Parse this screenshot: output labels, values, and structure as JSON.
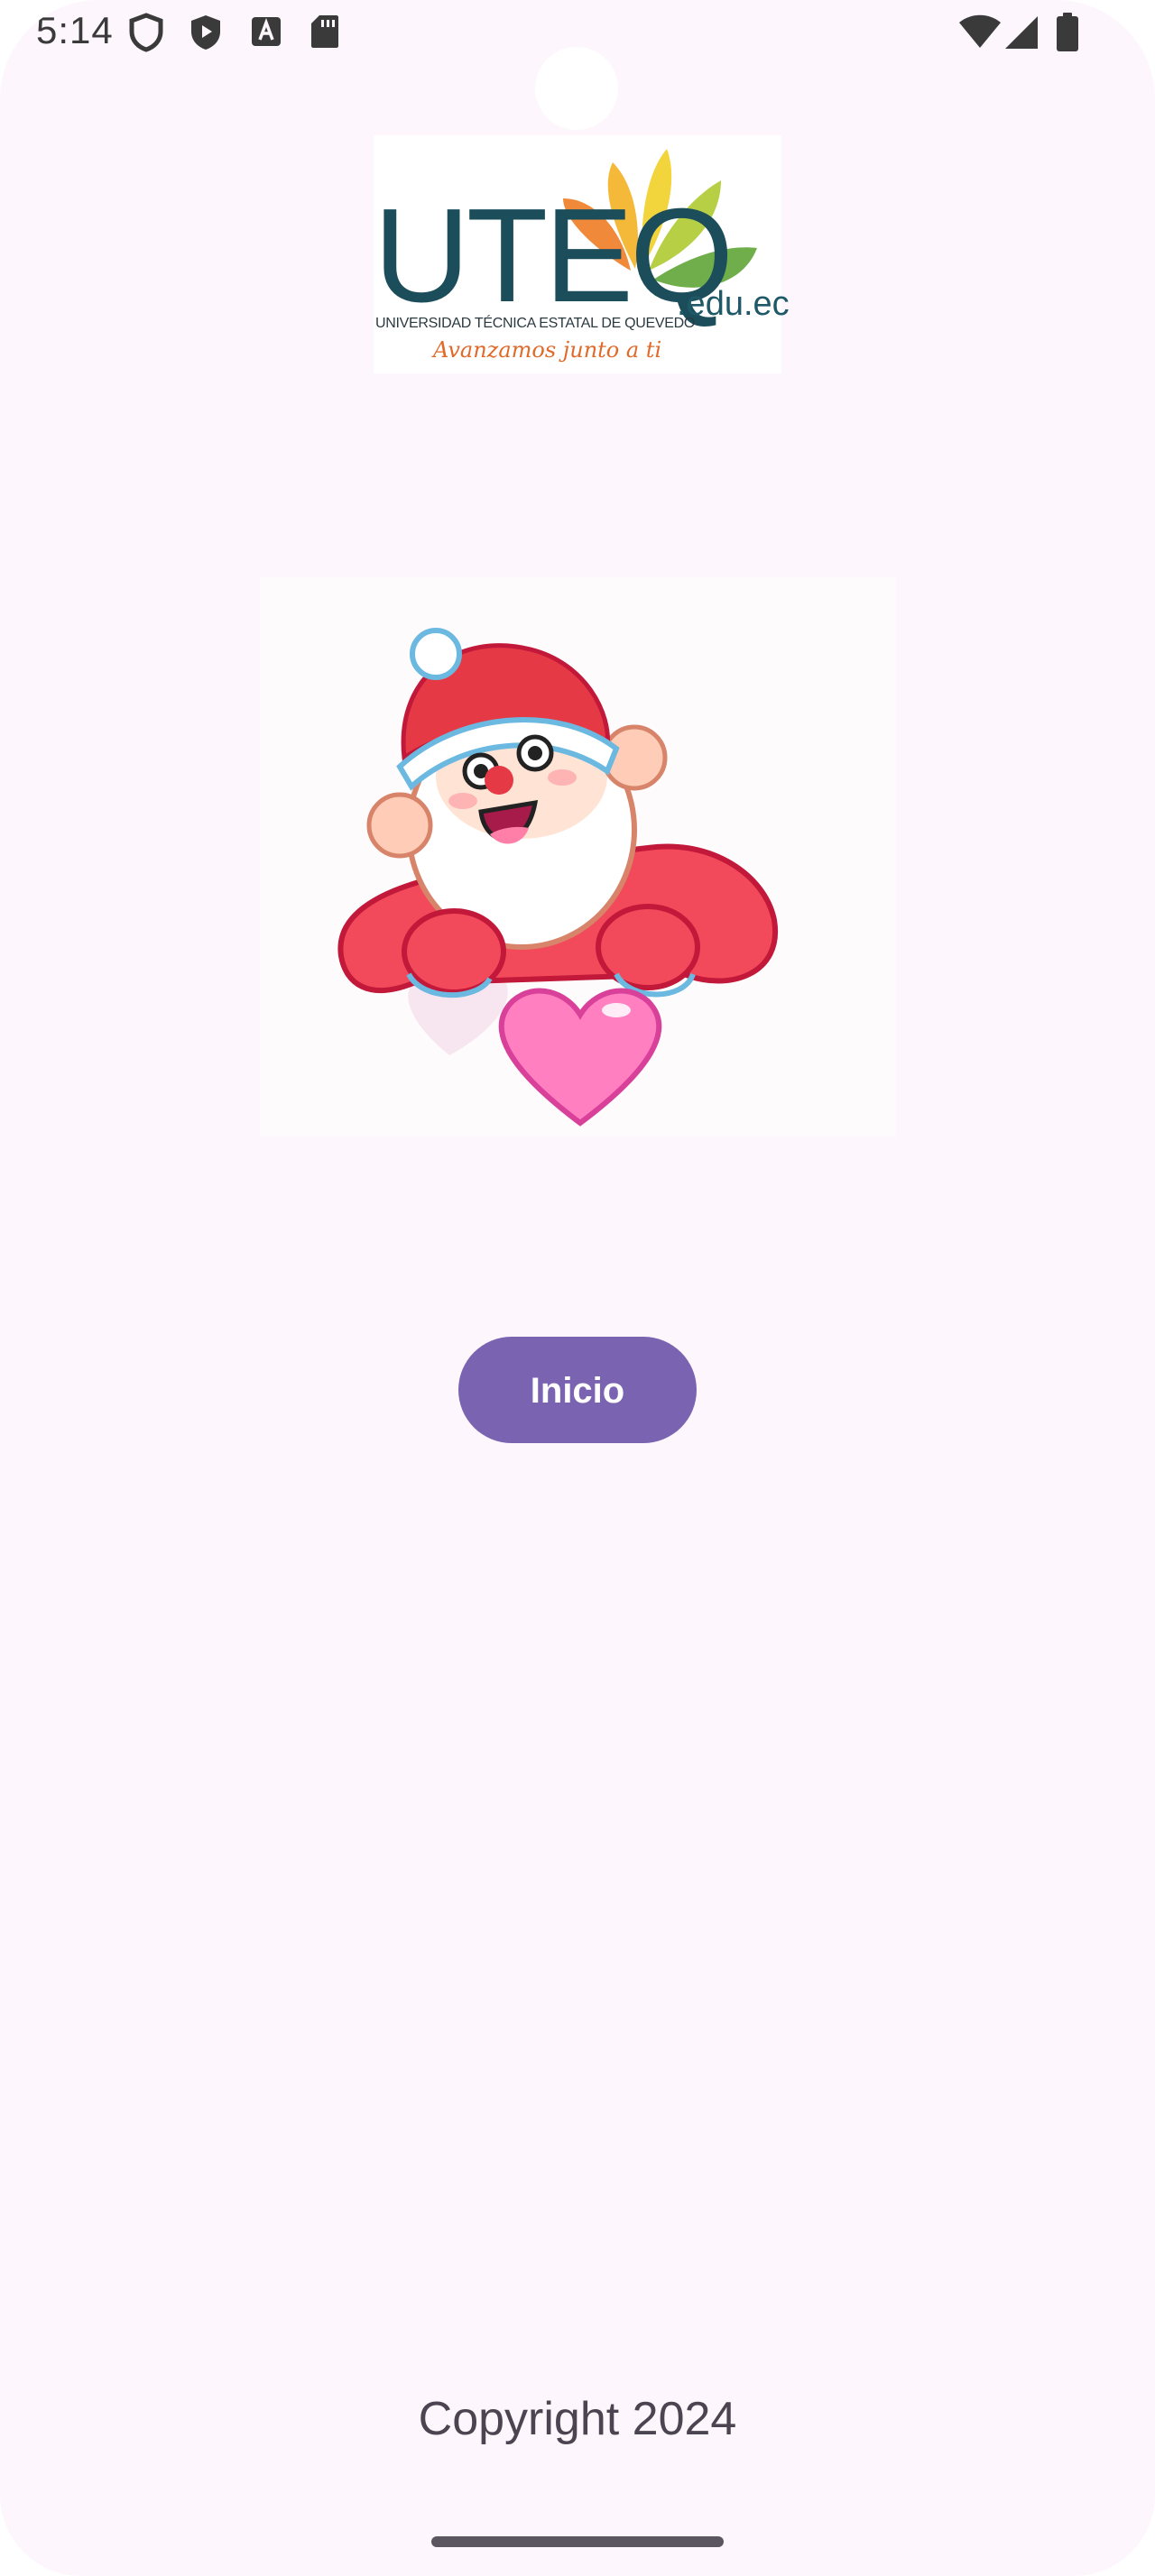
{
  "status_bar": {
    "time": "5:14",
    "left_icons": [
      "shield-outline-icon",
      "shield-play-icon",
      "font-download-icon",
      "sd-card-icon"
    ],
    "right_icons": [
      "wifi-icon",
      "cell-signal-icon",
      "battery-icon"
    ]
  },
  "logo": {
    "name": "UTEQ",
    "domain": ".edu.ec",
    "subtitle": "UNIVERSIDAD TÉCNICA ESTATAL DE QUEVEDO",
    "slogan": "Avanzamos junto a ti",
    "colors": {
      "text": "#1b4e5a",
      "slogan": "#e06a2a",
      "leaves": [
        "#f08a3a",
        "#f5b93a",
        "#f2d43c",
        "#b7cf44",
        "#6fae4a"
      ]
    }
  },
  "illustration": {
    "subject": "santa-with-heart"
  },
  "main": {
    "start_button_label": "Inicio"
  },
  "footer": {
    "copyright": "Copyright 2024"
  },
  "colors": {
    "background": "#fdf6fc",
    "accent": "#7a63b1"
  }
}
